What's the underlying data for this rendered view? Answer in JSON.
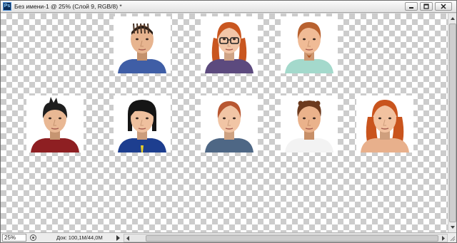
{
  "window": {
    "app_icon": "Ps",
    "title": "Без имени-1 @ 25% (Слой 9, RGB/8) *",
    "buttons": {
      "minimize_icon": "minimize-icon",
      "maximize_icon": "maximize-icon",
      "close_icon": "close-icon"
    }
  },
  "status": {
    "zoom": "25%",
    "doc_info": "Док: 100,1M/44,0M"
  },
  "portraits": [
    {
      "name": "portrait-man-braids",
      "skin": "#e7b48f",
      "hair": "#2a1d16",
      "shirt": "#3f5ea6",
      "hair_style": "braids"
    },
    {
      "name": "portrait-woman-glasses",
      "skin": "#f2c6a8",
      "hair": "#c9561f",
      "shirt": "#5c4a7e",
      "hair_style": "pigtails",
      "glasses": true
    },
    {
      "name": "portrait-man-goatee",
      "skin": "#f0bb96",
      "hair": "#b8612f",
      "shirt": "#a4d9cc",
      "hair_style": "short"
    },
    {
      "name": "portrait-boy-red-sweater",
      "skin": "#e9b894",
      "hair": "#1e1e1e",
      "shirt": "#8e1f22",
      "hair_style": "spiky"
    },
    {
      "name": "portrait-man-blue-suit",
      "skin": "#efc09e",
      "hair": "#151515",
      "shirt": "#1d3e8f",
      "hair_style": "bowl"
    },
    {
      "name": "portrait-woman-blue-top",
      "skin": "#f1c5a5",
      "hair": "#b85731",
      "shirt": "#4e6785",
      "hair_style": "bun"
    },
    {
      "name": "portrait-man-white-shirt",
      "skin": "#eab28b",
      "hair": "#6c3a1e",
      "shirt": "#f3f3f3",
      "hair_style": "curly"
    },
    {
      "name": "portrait-woman-wavy-hair",
      "skin": "#f2c2a0",
      "hair": "#c9541d",
      "shirt": "#e8b08c",
      "hair_style": "wavy"
    }
  ]
}
